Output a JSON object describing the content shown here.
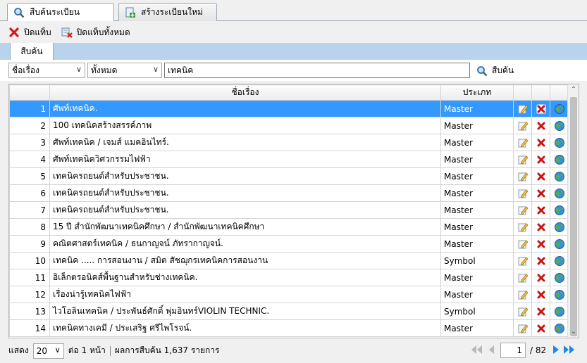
{
  "top_tabs": [
    {
      "label": "สืบค้นระเบียน",
      "active": true
    },
    {
      "label": "สร้างระเบียนใหม่",
      "active": false
    }
  ],
  "toolbar": {
    "close_tab": "ปิดแท็บ",
    "close_all_tabs": "ปิดแท็บทั้งหมด"
  },
  "inner_tab": {
    "label": "สืบค้น"
  },
  "search": {
    "field_select": "ชื่อเรื่อง",
    "match_select": "ทั้งหมด",
    "query": "เทคนิค",
    "button": "สืบค้น"
  },
  "table": {
    "headers": {
      "num": "",
      "title": "ชื่อเรื่อง",
      "type": "ประเภท"
    },
    "rows": [
      {
        "num": "1",
        "title": "ศัพท์เทคนิค.",
        "type": "Master",
        "selected": true
      },
      {
        "num": "2",
        "title": "100 เทคนิคสร้างสรรค์ภาพ",
        "type": "Master"
      },
      {
        "num": "3",
        "title": "ศัพท์เทคนิค / เจมส์ แมคอินไทร์.",
        "type": "Master"
      },
      {
        "num": "4",
        "title": "ศัพท์เทคนิควิศวกรรมไฟฟ้า",
        "type": "Master"
      },
      {
        "num": "5",
        "title": "เทคนิครถยนต์สำหรับประชาชน.",
        "type": "Master"
      },
      {
        "num": "6",
        "title": "เทคนิครถยนต์สำหรับประชาชน.",
        "type": "Master"
      },
      {
        "num": "7",
        "title": "เทคนิครถยนต์สำหรับประชาชน.",
        "type": "Master"
      },
      {
        "num": "8",
        "title": "15 ปี สำนักพัฒนาเทคนิคศึกษา / สำนักพัฒนาเทคนิคศึกษา",
        "type": "Master"
      },
      {
        "num": "9",
        "title": "คณิตศาสตร์เทคนิค / ธนกาญจน์ ภัทรากาญจน์.",
        "type": "Master"
      },
      {
        "num": "10",
        "title": "เทคนิค ..... การสอนงาน / สมิต สัชฌุกรเทคนิคการสอนงาน",
        "type": "Symbol"
      },
      {
        "num": "11",
        "title": "อิเล็กตรอนิคส์พื้นฐานสำหรับช่างเทคนิค.",
        "type": "Master"
      },
      {
        "num": "12",
        "title": "เรื่องน่ารู้เทคนิคไฟฟ้า",
        "type": "Master"
      },
      {
        "num": "13",
        "title": "ไวโอลินเทคนิค / ประพันธ์ศักดิ์ พุ่มอินทร์VIOLIN TECHNIC.",
        "type": "Symbol"
      },
      {
        "num": "14",
        "title": "เทคนิคทางเคมี / ประเสริฐ ศรีไพโรจน์.",
        "type": "Master"
      }
    ]
  },
  "footer": {
    "show_label": "แสดง",
    "per_page": "20",
    "per_page_suffix": "ต่อ 1 หน้า",
    "result_text": "ผลการสืบค้น 1,637 รายการ",
    "page_current": "1",
    "page_total": "/ 82"
  },
  "colors": {
    "selection": "#3399ff",
    "tab_bar": "#b9d3ec",
    "delete_red": "#cc1111",
    "nav_blue": "#1e88e5"
  }
}
